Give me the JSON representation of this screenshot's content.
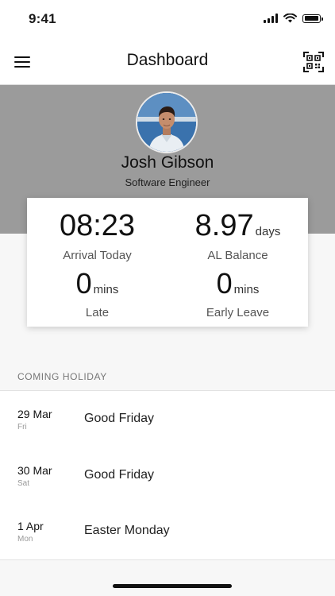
{
  "status_bar": {
    "time": "9:41"
  },
  "nav": {
    "title": "Dashboard",
    "menu_icon": "hamburger-menu-icon",
    "qr_icon": "qr-scan-icon"
  },
  "profile": {
    "name": "Josh Gibson",
    "role": "Software Engineer"
  },
  "stats": {
    "arrival": {
      "value": "08:23",
      "label": "Arrival Today"
    },
    "al_balance": {
      "value": "8.97",
      "unit": "days",
      "label": "AL Balance"
    },
    "late": {
      "value": "0",
      "unit": "mins",
      "label": "Late"
    },
    "early_leave": {
      "value": "0",
      "unit": "mins",
      "label": "Early Leave"
    }
  },
  "holidays": {
    "header": "COMING HOLIDAY",
    "items": [
      {
        "date": "29 Mar",
        "day": "Fri",
        "name": "Good Friday"
      },
      {
        "date": "30 Mar",
        "day": "Sat",
        "name": "Good Friday"
      },
      {
        "date": "1 Apr",
        "day": "Mon",
        "name": "Easter Monday"
      }
    ]
  },
  "colors": {
    "banner": "#9b9b9b",
    "card": "#ffffff",
    "background": "#f7f7f7"
  }
}
